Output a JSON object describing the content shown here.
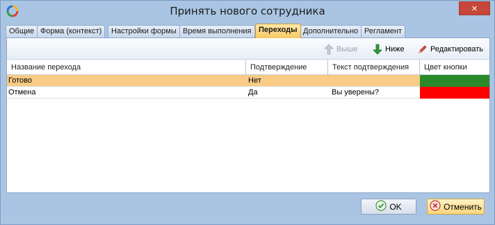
{
  "window": {
    "title": "Принять нового сотрудника",
    "close_symbol": "✕",
    "accent": "#a9c5e3"
  },
  "tabs": [
    {
      "label": "Общие",
      "active": false
    },
    {
      "label": "Форма (контекст)",
      "active": false
    },
    {
      "label": "Настройки формы",
      "active": false
    },
    {
      "label": "Время выполнения",
      "active": false
    },
    {
      "label": "Переходы",
      "active": true
    },
    {
      "label": "Дополнительно",
      "active": false
    },
    {
      "label": "Регламент",
      "active": false
    }
  ],
  "toolbar": {
    "up_label": "Выше",
    "down_label": "Ниже",
    "edit_label": "Редактировать"
  },
  "grid": {
    "columns": [
      "Название перехода",
      "Подтверждение",
      "Текст подтверждения",
      "Цвет кнопки"
    ],
    "rows": [
      {
        "name": "Готово",
        "confirm": "Нет",
        "confirm_text": "",
        "color": "#2a8a2a",
        "selected": true
      },
      {
        "name": "Отмена",
        "confirm": "Да",
        "confirm_text": "Вы уверены?",
        "color": "#ff0000",
        "selected": false
      }
    ]
  },
  "buttons": {
    "ok_label": "OK",
    "cancel_label": "Отменить"
  }
}
